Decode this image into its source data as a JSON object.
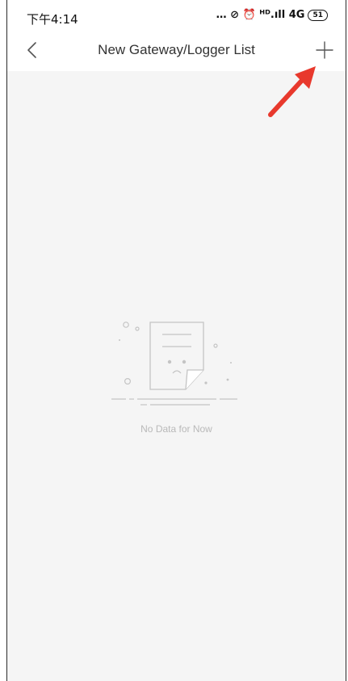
{
  "status_bar": {
    "time": "下午4:14",
    "indicators": "… ⊘ ⏰ ᴴᴰ.ıll 4G",
    "battery": "51"
  },
  "navbar": {
    "title": "New Gateway/Logger List",
    "back_icon": "chevron-left-icon",
    "add_icon": "plus-icon"
  },
  "empty_state": {
    "message": "No Data for Now",
    "illustration": "sad-document-icon"
  },
  "annotation": {
    "arrow_color": "#e8392d"
  }
}
